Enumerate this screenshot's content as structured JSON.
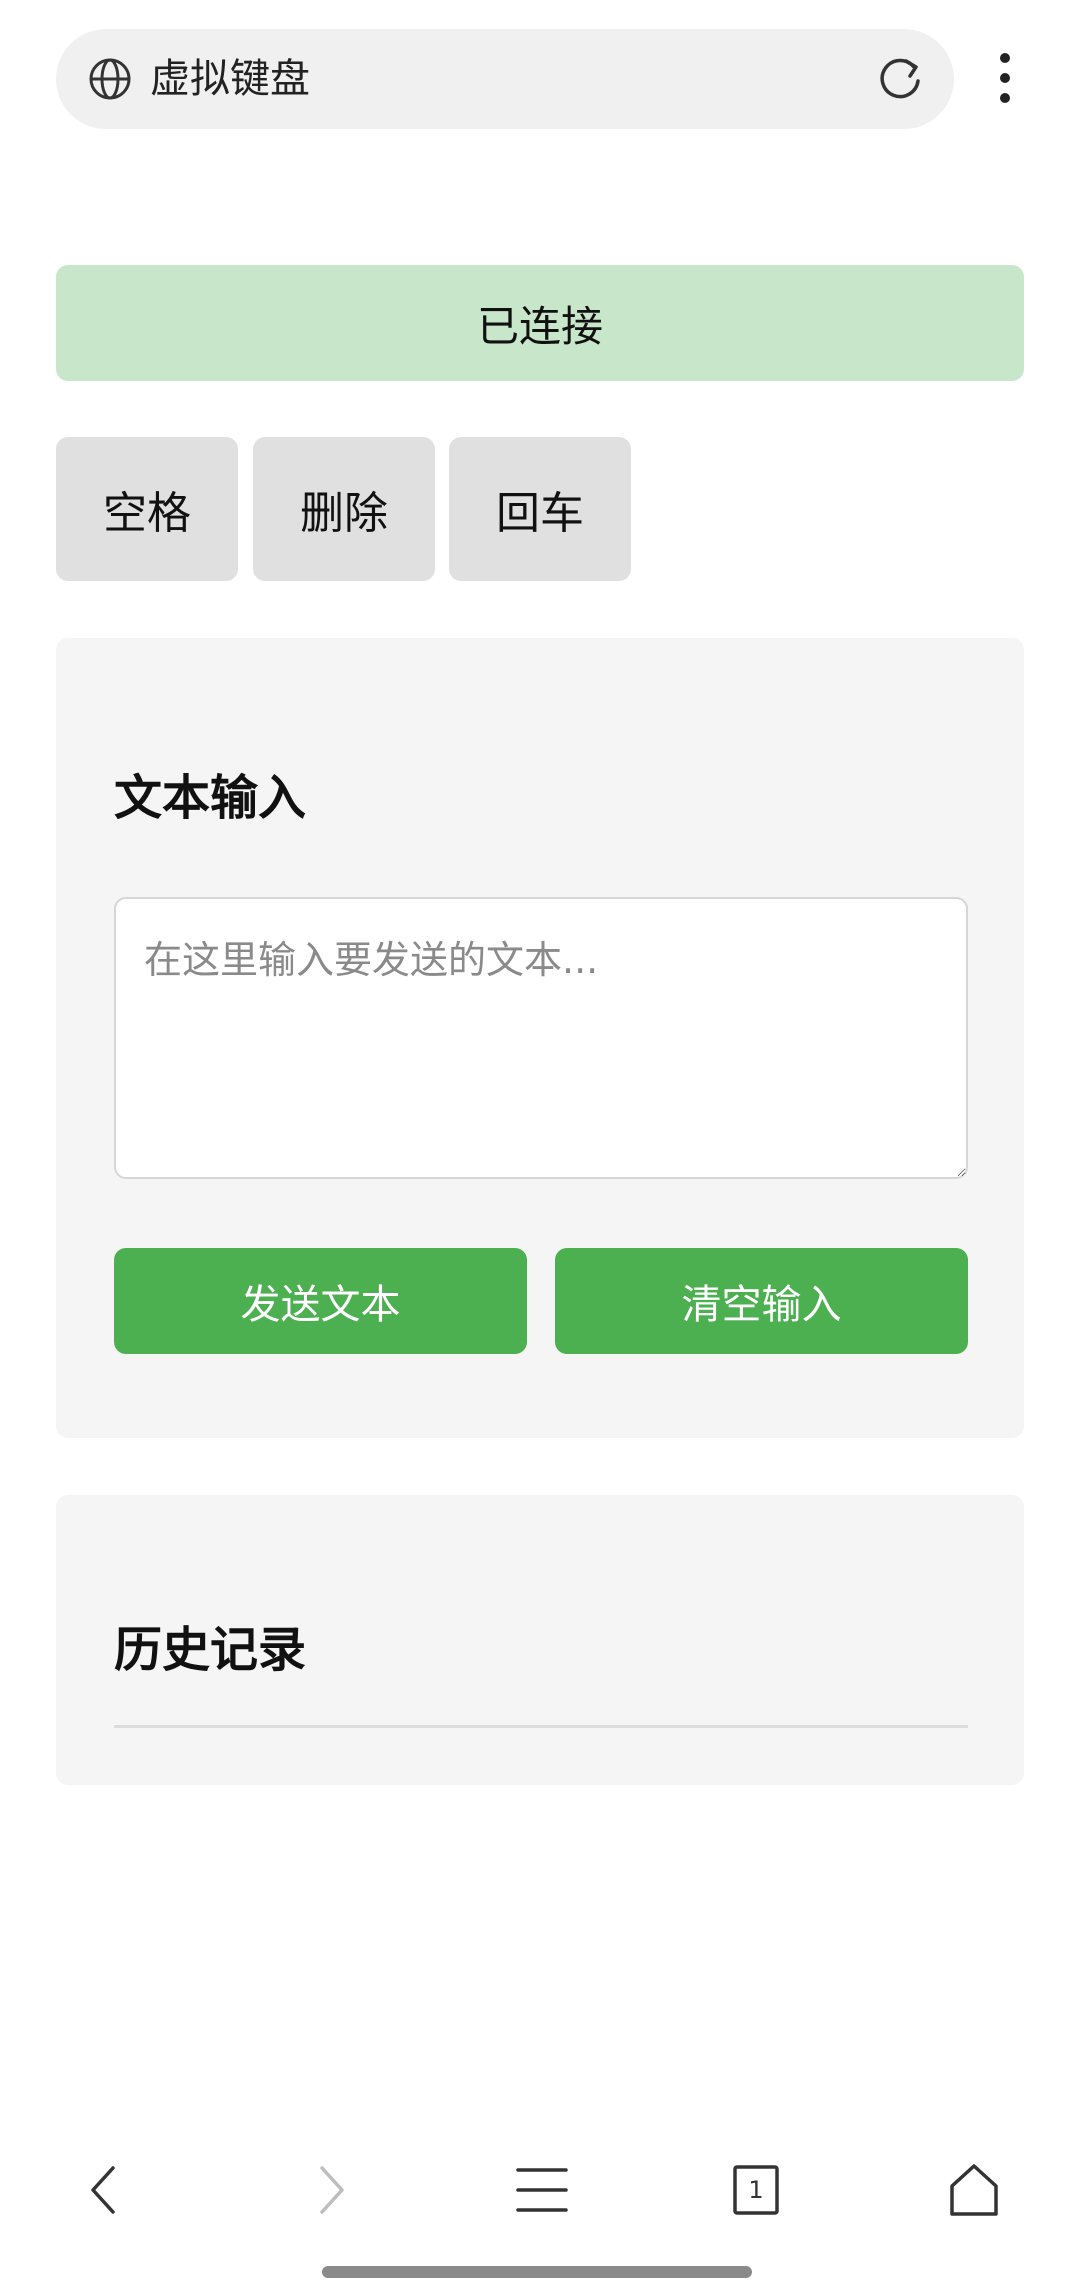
{
  "browser": {
    "url_text": "虚拟键盘",
    "icons": {
      "globe": "globe-icon",
      "reload": "reload-icon",
      "menu": "more-vert-icon"
    }
  },
  "status": {
    "label": "已连接",
    "color": "#c8e6c9"
  },
  "keys": {
    "space": "空格",
    "delete": "删除",
    "enter": "回车",
    "color": "#e0e0e0"
  },
  "text_card": {
    "title": "文本输入",
    "input_placeholder": "在这里输入要发送的文本...",
    "input_value": "",
    "send_label": "发送文本",
    "clear_label": "清空输入",
    "button_color": "#4caf50"
  },
  "history_card": {
    "title": "历史记录"
  },
  "bottom_nav": {
    "tab_count": "1",
    "icons": [
      "back-icon",
      "forward-icon",
      "menu-icon",
      "tabs-icon",
      "home-icon"
    ]
  }
}
